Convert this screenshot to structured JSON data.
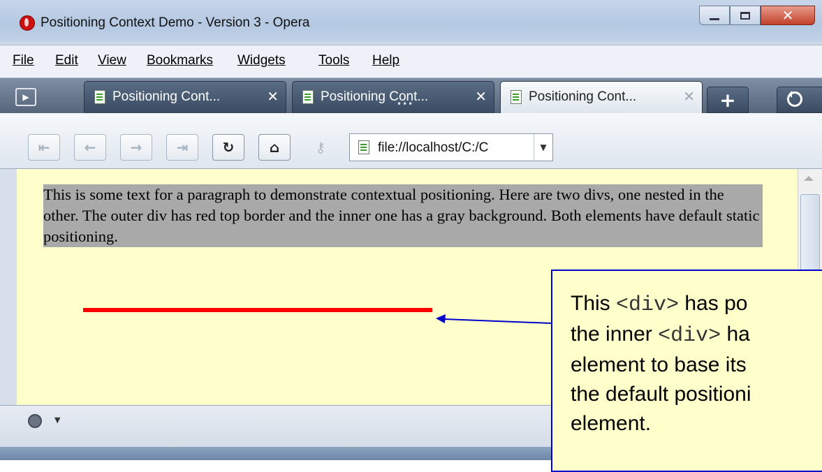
{
  "window": {
    "title": "Positioning Context Demo - Version 3 - Opera"
  },
  "menu": {
    "file": "File",
    "edit": "Edit",
    "view": "View",
    "bookmarks": "Bookmarks",
    "widgets": "Widgets",
    "tools": "Tools",
    "help": "Help"
  },
  "tabs": [
    {
      "label": "Positioning Cont...",
      "active": false
    },
    {
      "label": "Positioning Cont...",
      "active": false
    },
    {
      "label": "Positioning Cont...",
      "active": true
    }
  ],
  "address": {
    "url": "file://localhost/C:/C"
  },
  "page": {
    "paragraph": "This is some text for a paragraph to demonstrate contextual positioning. Here are two divs, one nested in the other. The outer div has red top border and the inner one has a gray background. Both elements have default static positioning.",
    "outer_div_border_color": "#ff0000",
    "background_color": "#ffffcc",
    "paragraph_background": "#a9a9a9"
  },
  "callout": {
    "line1_a": "This ",
    "line1_code": "<div>",
    "line1_b": "  has po",
    "line2_a": "the inner ",
    "line2_code": "<div>",
    "line2_b": "  ha",
    "line3": "element to base its",
    "line4": "the default positioni",
    "line5": "element.",
    "border_color": "#0000cc"
  }
}
